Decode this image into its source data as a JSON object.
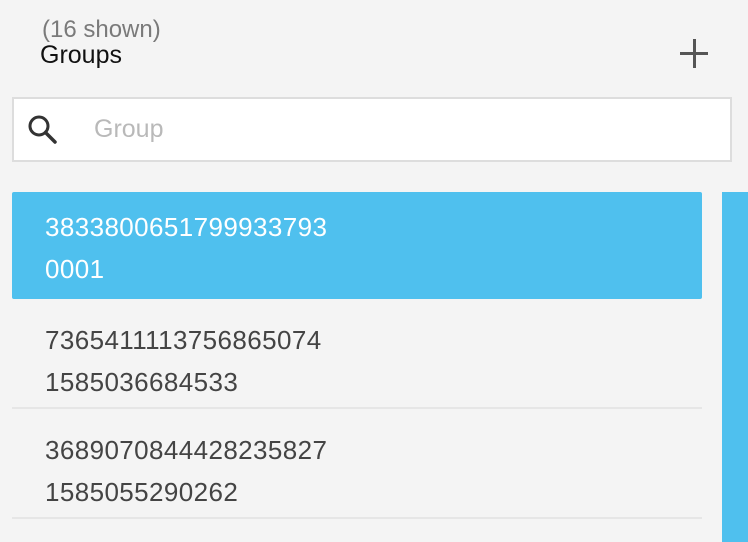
{
  "header": {
    "count_label": "(16 shown)",
    "title": "Groups",
    "add_icon": "plus-icon"
  },
  "search": {
    "placeholder": "Group",
    "value": "",
    "icon": "search-icon"
  },
  "groups": [
    {
      "line1": "3833800651799933793",
      "line2": "0001",
      "selected": true
    },
    {
      "line1": "7365411113756865074",
      "line2": "1585036684533",
      "selected": false
    },
    {
      "line1": "3689070844428235827",
      "line2": "1585055290262",
      "selected": false
    }
  ],
  "colors": {
    "accent": "#4fc0ee",
    "background": "#f4f4f4"
  }
}
